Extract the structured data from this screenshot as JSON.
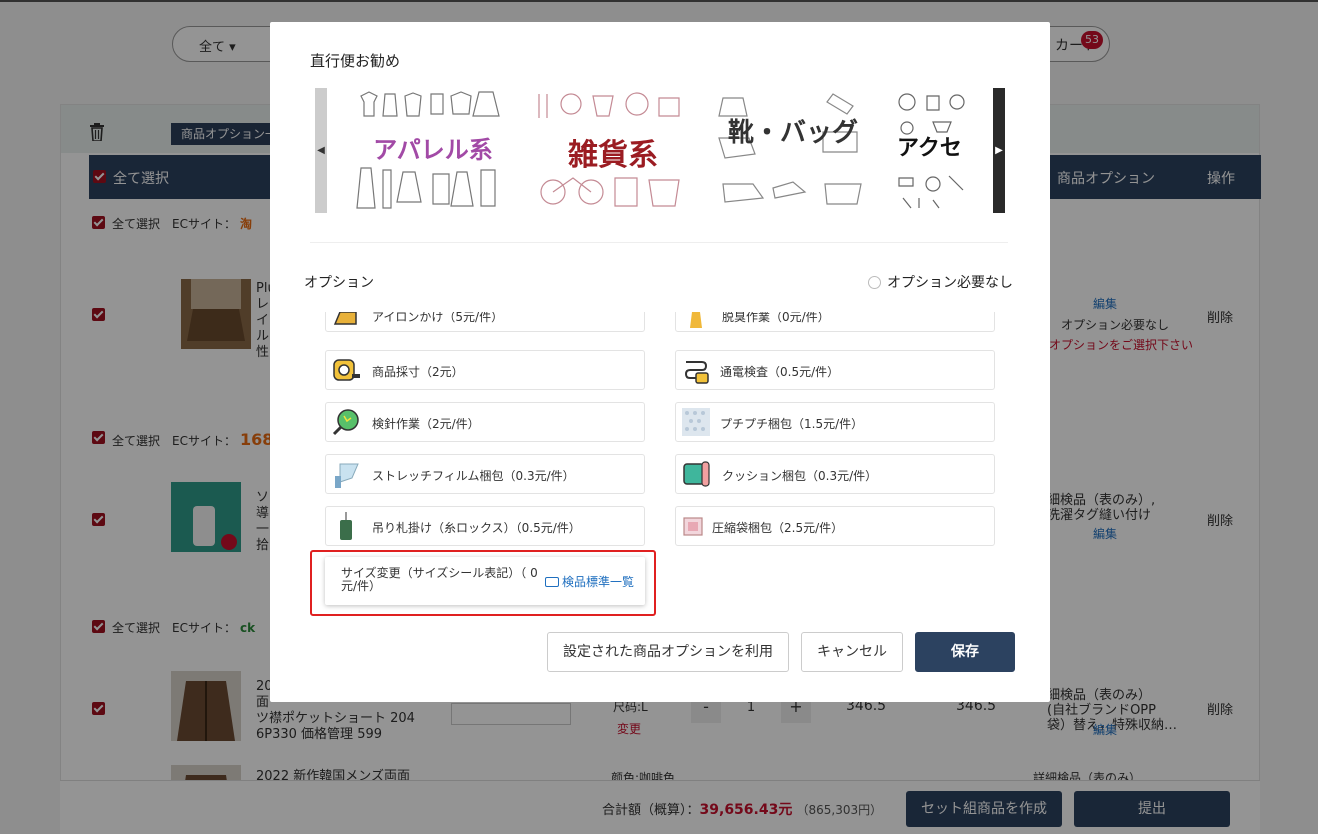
{
  "background": {
    "search_all": "全て ▾",
    "cart_label": "カート",
    "cart_count": "53",
    "option_tag": "商品オプション一",
    "header": {
      "select_all": "全て選択",
      "product_option": "商品オプション",
      "action": "操作"
    },
    "shops": [
      {
        "select_all": "全て選択",
        "ec_label": "ECサイト：",
        "logo": "淘"
      },
      {
        "select_all": "全て選択",
        "ec_label": "ECサイト：",
        "logo": "168"
      },
      {
        "select_all": "全て選択",
        "ec_label": "ECサイト：",
        "logo": "ck"
      }
    ],
    "products": [
      {
        "title_lines": [
          "Plu",
          "レ",
          "イ",
          "ル",
          "性"
        ],
        "edit": "編集",
        "option_none": "オプション必要なし",
        "option_warning": "オプションをご選択下さい",
        "delete": "削除"
      },
      {
        "title_lines": [
          "ソ",
          "導",
          "一",
          "拾"
        ],
        "option_lines": [
          "細検品（表のみ）,",
          "洗濯タグ縫い付け"
        ],
        "edit": "編集",
        "delete": "削除"
      },
      {
        "title_lines": [
          "20",
          "面",
          "ツ襟ポケットショート 204",
          "6P330 価格管理 599"
        ],
        "size": "尺码:L",
        "change": "変更",
        "qty": "1",
        "minus": "-",
        "plus": "+",
        "price": "346.5",
        "subtotal": "346.5",
        "option_lines": [
          "細検品（表のみ）",
          "(自社ブランドOPP",
          "袋）替え，特殊収納…"
        ],
        "edit": "編集",
        "delete": "削除"
      },
      {
        "title_lines": [
          "2022 新作韓国メンズ両面"
        ],
        "color": "颜色:咖啡色",
        "option_lines": [
          "詳細検品（表のみ）"
        ]
      }
    ],
    "bottom": {
      "total_label": "合計額（概算）：",
      "total_amount": "39,656.43元",
      "total_sub": "（865,303円）",
      "set_button": "セット組商品を作成",
      "submit_button": "提出"
    }
  },
  "modal": {
    "title": "直行便お勧め",
    "banners": [
      {
        "text": "アパレル系",
        "color": "#a24aa6"
      },
      {
        "text": "雑貨系",
        "color": "#9b1c22"
      },
      {
        "text": "靴・バッグ",
        "color": "#333333"
      },
      {
        "text": "アクセ",
        "color": "#111111"
      }
    ],
    "options_title": "オプション",
    "no_option": "オプション必要なし",
    "options": [
      {
        "label": "アイロンかけ（5元/件）",
        "icon": "iron-icon"
      },
      {
        "label": "脱臭作業（0元/件）",
        "icon": "spray-icon"
      },
      {
        "label": "商品採寸（2元）",
        "icon": "tape-measure-icon"
      },
      {
        "label": "通電検査（0.5元/件）",
        "icon": "plug-icon"
      },
      {
        "label": "検針作業（2元/件）",
        "icon": "needle-detector-icon"
      },
      {
        "label": "プチプチ梱包（1.5元/件）",
        "icon": "bubble-wrap-icon"
      },
      {
        "label": "ストレッチフィルム梱包（0.3元/件）",
        "icon": "stretch-film-icon"
      },
      {
        "label": "クッション梱包（0.3元/件）",
        "icon": "cushion-icon"
      },
      {
        "label": "吊り札掛け（糸ロックス）（0.5元/件）",
        "icon": "hang-tag-icon"
      },
      {
        "label": "圧縮袋梱包（2.5元/件）",
        "icon": "compression-bag-icon"
      }
    ],
    "size_option": {
      "label": "サイズ変更（サイズシール表記）（ 0元/件）",
      "link": "検品標準一覧"
    },
    "buttons": {
      "use_preset": "設定された商品オプションを利用",
      "cancel": "キャンセル",
      "save": "保存"
    }
  }
}
